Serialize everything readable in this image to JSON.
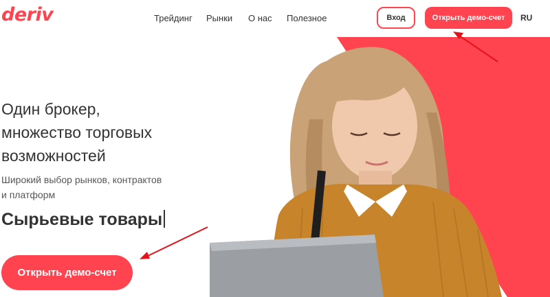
{
  "header": {
    "logo_text": "deriv",
    "nav": [
      {
        "label": "Трейдинг"
      },
      {
        "label": "Рынки"
      },
      {
        "label": "О нас"
      },
      {
        "label": "Полезное"
      }
    ],
    "login_label": "Вход",
    "demo_label": "Открыть демо-счет",
    "language": "RU"
  },
  "hero": {
    "headline_lines": [
      "Один брокер,",
      "множество торговых",
      "возможностей"
    ],
    "sub_lines": [
      "Широкий выбор рынков, контрактов",
      "и платформ"
    ],
    "rotating_text": "Сырьевые товары",
    "cta_label": "Открыть демо-счет"
  },
  "colors": {
    "brand": "#ff444f",
    "text": "#333333",
    "annotation_arrow": "#e3131b",
    "sweater": "#c7842a",
    "hair": "#c9a277",
    "laptop": "#9b9ea3"
  },
  "icons": {
    "annotation": "arrow-icon"
  }
}
